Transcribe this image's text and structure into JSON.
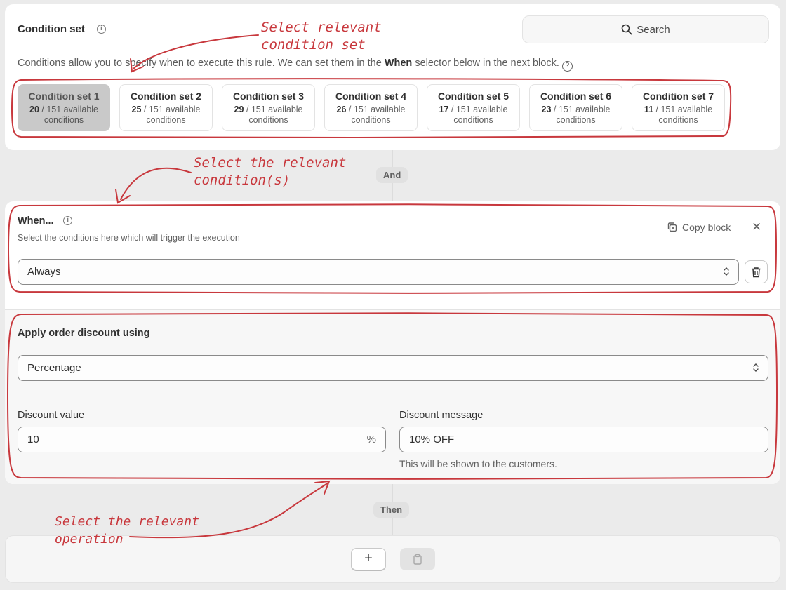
{
  "condition_card": {
    "title": "Condition set",
    "search_placeholder": "Search",
    "description_pre": "Conditions allow you to specify when to execute this rule. We can set them in the ",
    "description_bold": "When",
    "description_post": " selector below in the next block.",
    "sets": [
      {
        "name": "Condition set 1",
        "count": "20",
        "total": " / 151 available",
        "suffix": "conditions",
        "active": true
      },
      {
        "name": "Condition set 2",
        "count": "25",
        "total": " / 151 available",
        "suffix": "conditions",
        "active": false
      },
      {
        "name": "Condition set 3",
        "count": "29",
        "total": " / 151 available",
        "suffix": "conditions",
        "active": false
      },
      {
        "name": "Condition set 4",
        "count": "26",
        "total": " / 151 available",
        "suffix": "conditions",
        "active": false
      },
      {
        "name": "Condition set 5",
        "count": "17",
        "total": " / 151 available",
        "suffix": "conditions",
        "active": false
      },
      {
        "name": "Condition set 6",
        "count": "23",
        "total": " / 151 available",
        "suffix": "conditions",
        "active": false
      },
      {
        "name": "Condition set 7",
        "count": "11",
        "total": " / 151 available",
        "suffix": "conditions",
        "active": false
      }
    ]
  },
  "connectors": {
    "and": "And",
    "then": "Then"
  },
  "when_block": {
    "title": "When...",
    "subtitle": "Select the conditions here which will trigger the execution",
    "copy_label": "Copy block",
    "close_label": "✕",
    "condition_value": "Always"
  },
  "action_block": {
    "title": "Apply order discount using",
    "method_value": "Percentage",
    "discount_value_label": "Discount value",
    "discount_value": "10",
    "discount_suffix": "%",
    "discount_message_label": "Discount message",
    "discount_message": "10% OFF",
    "discount_message_help": "This will be shown to the customers."
  },
  "bottom": {
    "add_label": "+"
  },
  "annotations": {
    "set_line1": "Select relevant",
    "set_line2": "condition set",
    "cond_line1": "Select the relevant",
    "cond_line2": "condition(s)",
    "op_line1": "Select the relevant",
    "op_line2": "operation"
  },
  "colors": {
    "annotation": "#c8383d",
    "active_set": "#c9c9c9",
    "page_bg": "#ebebeb"
  }
}
